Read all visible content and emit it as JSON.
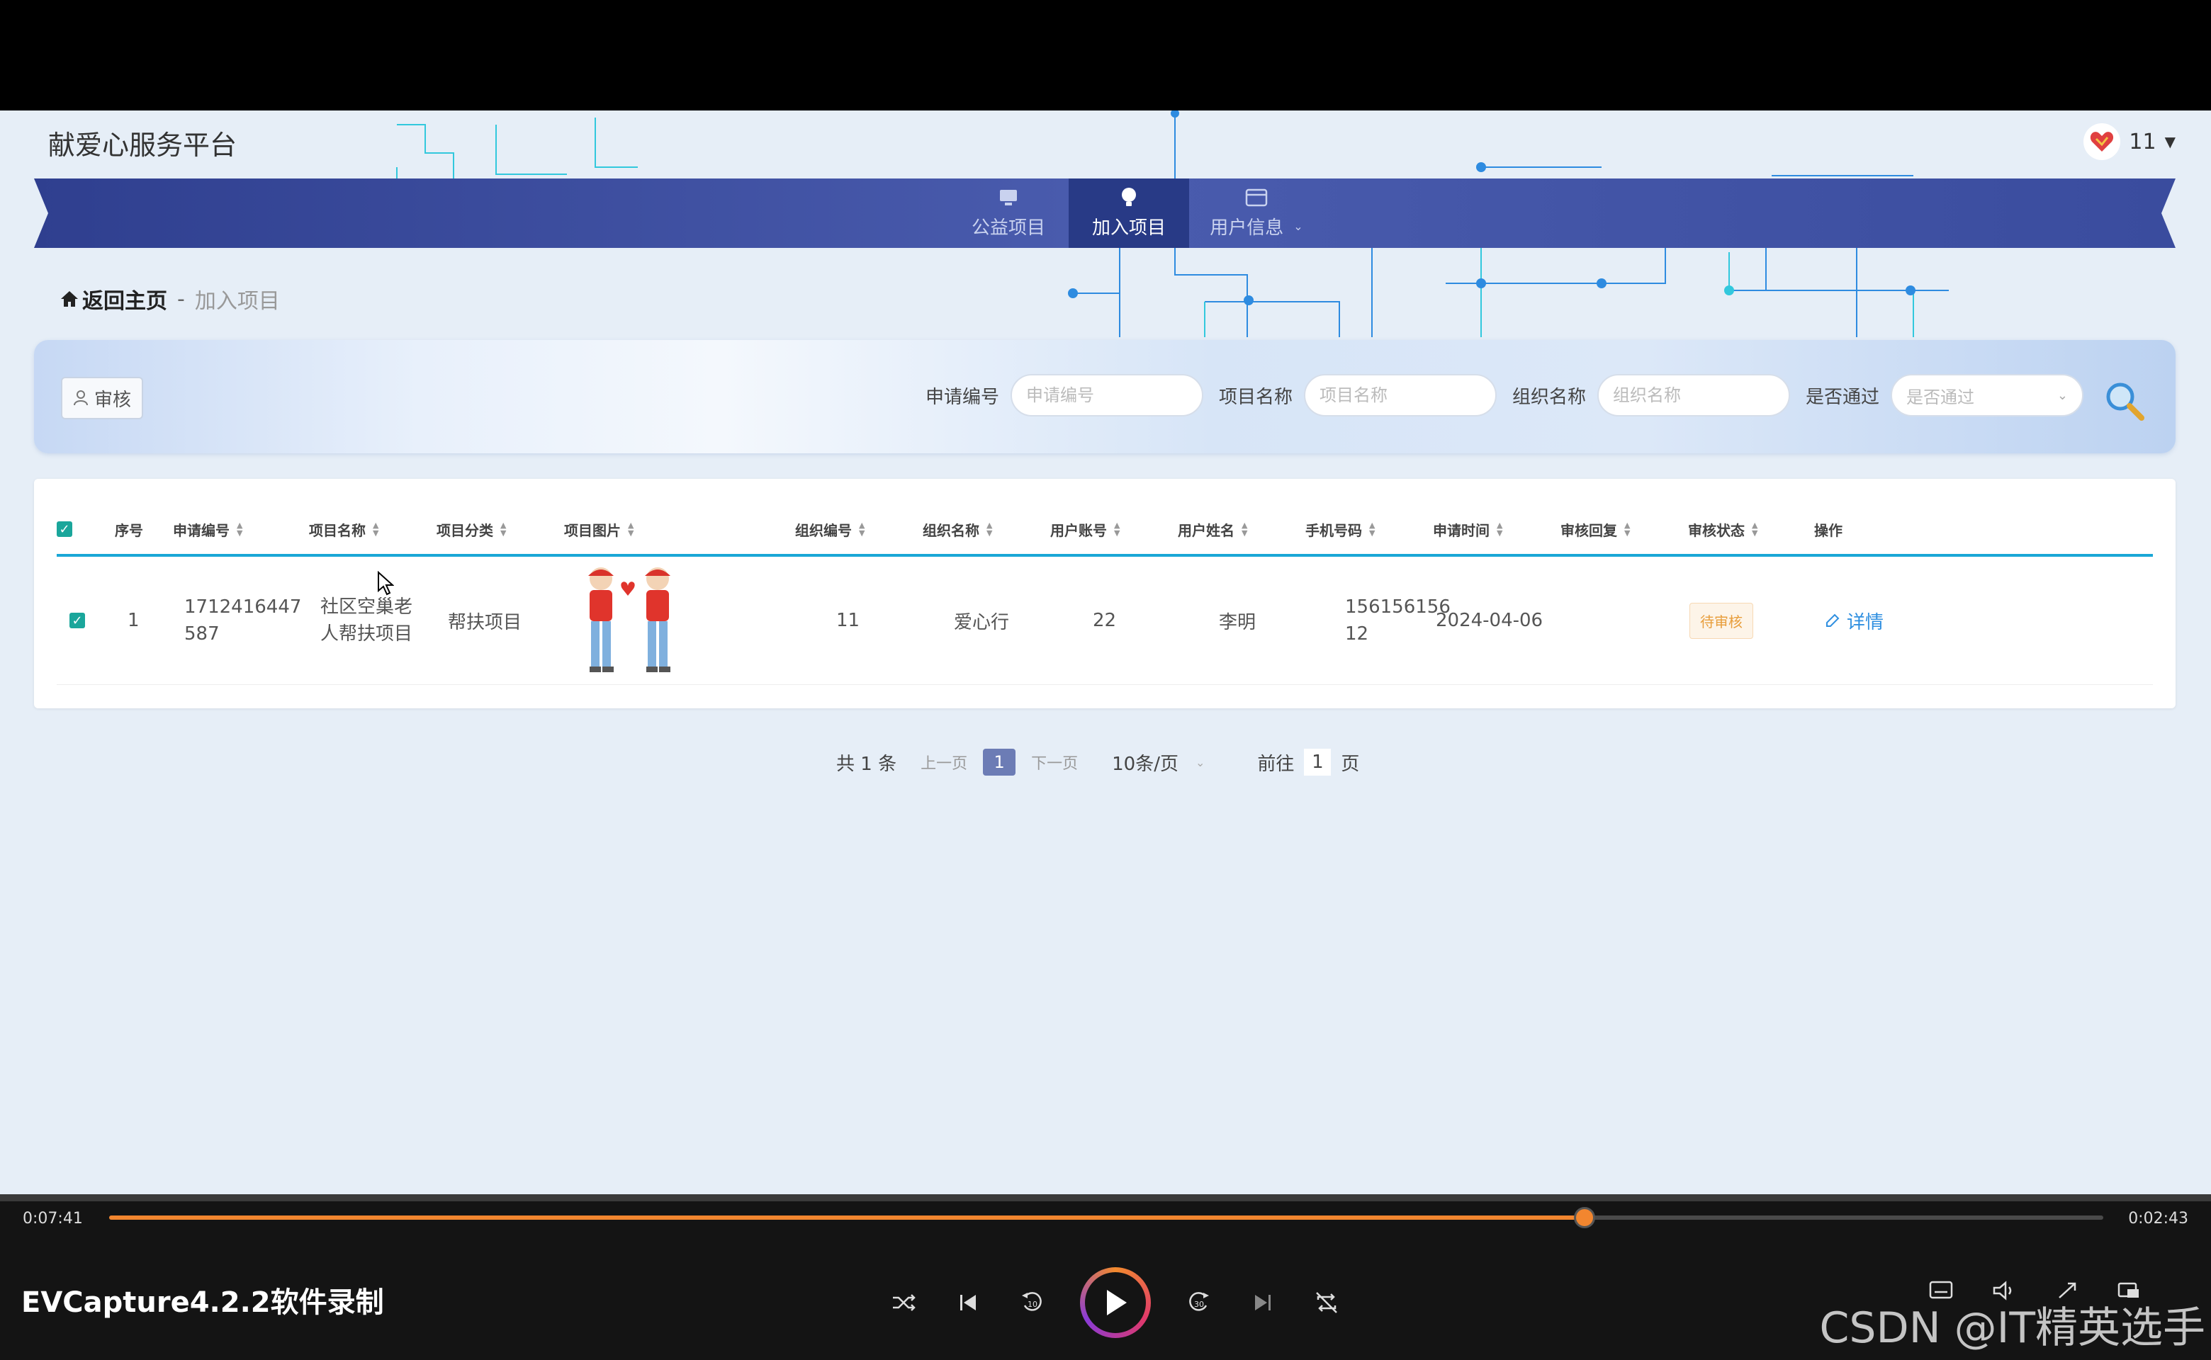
{
  "site": {
    "title": "献爱心服务平台",
    "user_name": "11"
  },
  "nav": {
    "items": [
      {
        "label": "公益项目"
      },
      {
        "label": "加入项目"
      },
      {
        "label": "用户信息"
      }
    ]
  },
  "breadcrumb": {
    "home": "返回主页",
    "separator": "-",
    "current": "加入项目"
  },
  "search": {
    "audit_button": "审核",
    "fields": [
      {
        "label": "申请编号",
        "placeholder": "申请编号"
      },
      {
        "label": "项目名称",
        "placeholder": "项目名称"
      },
      {
        "label": "组织名称",
        "placeholder": "组织名称"
      },
      {
        "label": "是否通过",
        "placeholder": "是否通过"
      }
    ]
  },
  "table": {
    "headers": [
      "序号",
      "申请编号",
      "项目名称",
      "项目分类",
      "项目图片",
      "组织编号",
      "组织名称",
      "用户账号",
      "用户姓名",
      "手机号码",
      "申请时间",
      "审核回复",
      "审核状态",
      "操作"
    ],
    "rows": [
      {
        "index": "1",
        "apply_no_line1": "1712416447",
        "apply_no_line2": "587",
        "project_name_line1": "社区空巢老",
        "project_name_line2": "人帮扶项目",
        "category": "帮扶项目",
        "org_no": "11",
        "org_name": "爱心行",
        "account": "22",
        "user_name": "李明",
        "phone_line1": "156156156",
        "phone_line2": "12",
        "apply_time": "2024-04-06",
        "reply": "",
        "status": "待审核",
        "action": "详情"
      }
    ]
  },
  "pagination": {
    "total": "共 1 条",
    "prev": "上一页",
    "page": "1",
    "next": "下一页",
    "page_size": "10条/页",
    "goto_prefix": "前往",
    "goto_value": "1",
    "goto_suffix": "页"
  },
  "player": {
    "elapsed": "0:07:41",
    "duration": "0:02:43",
    "progress": 0.74,
    "recorder": "EVCapture4.2.2软件录制",
    "watermark": "CSDN @IT精英选手"
  },
  "colors": {
    "nav_bar": "#3d4fa0",
    "nav_active": "#283a86",
    "accent_teal": "#1aa7d6",
    "progress": "#f2862f",
    "status_pending": "#e89e3c"
  }
}
